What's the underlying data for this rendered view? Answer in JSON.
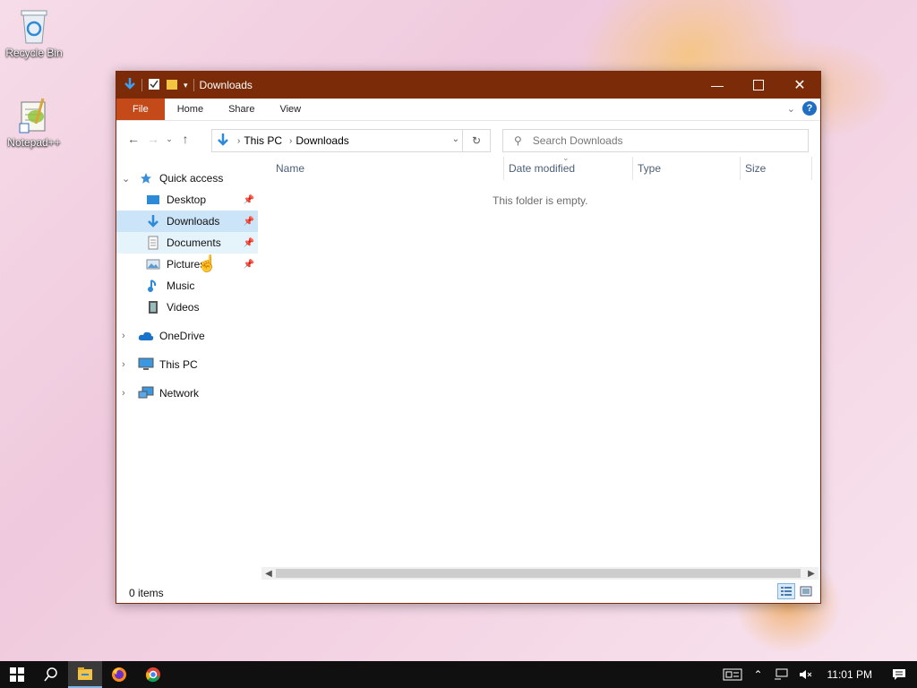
{
  "desktop": {
    "icons": [
      {
        "label": "Recycle Bin",
        "icon": "recycle-bin-icon"
      },
      {
        "label": "Notepad++",
        "icon": "notepad-plus-plus-icon"
      }
    ]
  },
  "window": {
    "title": "Downloads",
    "ribbon_tabs": [
      "File",
      "Home",
      "Share",
      "View"
    ],
    "address": {
      "crumbs": [
        "This PC",
        "Downloads"
      ]
    },
    "search_placeholder": "Search Downloads",
    "nav": {
      "quick_access": "Quick access",
      "quick_items": [
        "Desktop",
        "Downloads",
        "Documents",
        "Pictures",
        "Music",
        "Videos"
      ],
      "onedrive": "OneDrive",
      "this_pc": "This PC",
      "network": "Network"
    },
    "columns": [
      "Name",
      "Date modified",
      "Type",
      "Size"
    ],
    "empty_message": "This folder is empty.",
    "status": "0 items"
  },
  "taskbar": {
    "time": "11:01 PM",
    "apps": [
      "start-icon",
      "search-icon",
      "file-explorer-icon",
      "firefox-icon",
      "chrome-icon"
    ]
  },
  "colors": {
    "titlebar": "#7b2b07",
    "file_tab": "#c44a1a",
    "selection": "#cce4f7",
    "taskbar": "#101010"
  }
}
